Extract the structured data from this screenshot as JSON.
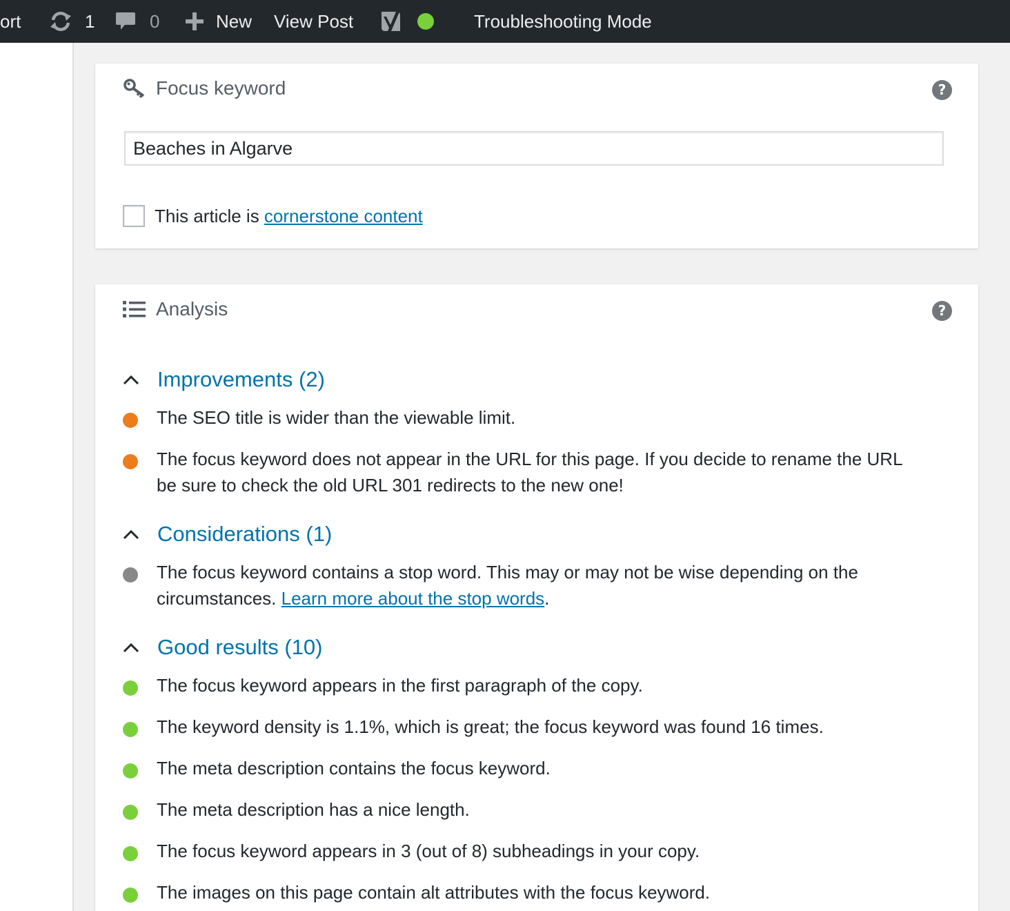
{
  "adminbar": {
    "partial_left_label": "ort",
    "updates_count": "1",
    "comments_count": "0",
    "new_label": "New",
    "view_post_label": "View Post",
    "troubleshooting_label": "Troubleshooting Mode",
    "status_color": "#7ad03a"
  },
  "focus_keyword": {
    "title": "Focus keyword",
    "help_label": "?",
    "input_value": "Beaches in Algarve",
    "cornerstone_prefix": "This article is ",
    "cornerstone_link": "cornerstone content",
    "cornerstone_checked": false
  },
  "analysis": {
    "title": "Analysis",
    "help_label": "?",
    "sections": [
      {
        "title": "Improvements (2)",
        "status": "orange",
        "items": [
          {
            "text": "The SEO title is wider than the viewable limit."
          },
          {
            "text": "The focus keyword does not appear in the URL for this page. If you decide to rename the URL be sure to check the old URL 301 redirects to the new one!"
          }
        ]
      },
      {
        "title": "Considerations (1)",
        "status": "gray",
        "items": [
          {
            "text": "The focus keyword contains a stop word. This may or may not be wise depending on the circumstances. ",
            "link": "Learn more about the stop words",
            "suffix": "."
          }
        ]
      },
      {
        "title": "Good results (10)",
        "status": "green",
        "items": [
          {
            "text": "The focus keyword appears in the first paragraph of the copy."
          },
          {
            "text": "The keyword density is 1.1%, which is great; the focus keyword was found 16 times."
          },
          {
            "text": "The meta description contains the focus keyword."
          },
          {
            "text": "The meta description has a nice length."
          },
          {
            "text": "The focus keyword appears in 3 (out of 8) subheadings in your copy."
          },
          {
            "text": "The images on this page contain alt attributes with the focus keyword."
          }
        ]
      }
    ]
  },
  "colors": {
    "adminbar_bg": "#23282d",
    "link": "#0073aa",
    "orange": "#ee7c1b",
    "gray": "#888888",
    "green": "#7ad03a"
  }
}
